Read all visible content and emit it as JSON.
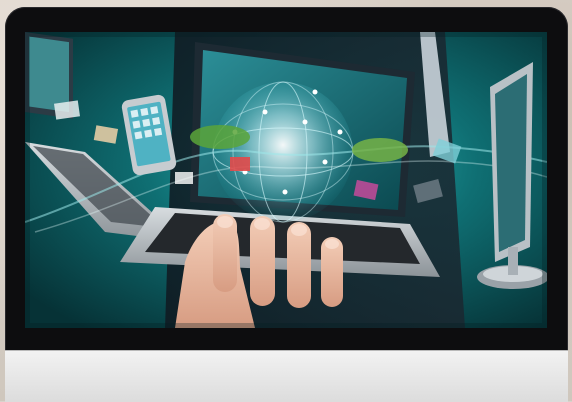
{
  "scene": {
    "description_icon": "monitor-icon",
    "colors": {
      "bezel": "#0d0d0f",
      "chin": "#e6e6e6",
      "screen_bg": "#0b4a4d",
      "accent_teal": "#1fa7a8",
      "globe_glow": "#bff6ff"
    }
  }
}
